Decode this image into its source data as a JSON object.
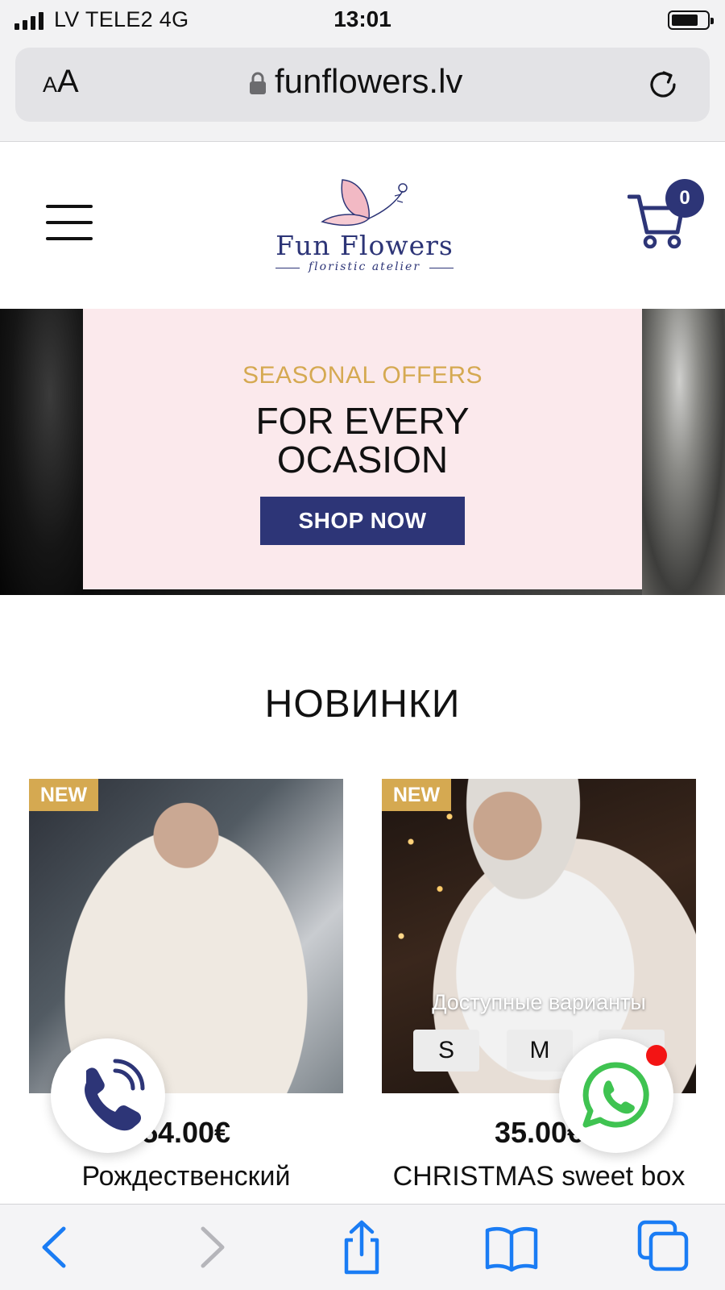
{
  "status_bar": {
    "carrier": "LV TELE2   4G",
    "time": "13:01"
  },
  "browser": {
    "text_size_small": "A",
    "text_size_large": "A",
    "url": "funflowers.lv",
    "icons": [
      "lock-icon",
      "reload-icon",
      "back-icon",
      "forward-icon",
      "share-icon",
      "bookmarks-icon",
      "tabs-icon"
    ]
  },
  "header": {
    "logo_title": "Fun Flowers",
    "logo_subtitle": "floristic atelier",
    "cart_count": "0",
    "icons": [
      "menu-icon",
      "cart-icon",
      "butterfly-logo-icon"
    ]
  },
  "hero": {
    "eyebrow": "SEASONAL OFFERS",
    "title_line1": "FOR EVERY",
    "title_line2": "OCASION",
    "button": "SHOP NOW"
  },
  "section": {
    "title": "НОВИНКИ"
  },
  "products": [
    {
      "badge": "NEW",
      "price": "54.00€",
      "name": "Рождественский"
    },
    {
      "badge": "NEW",
      "price": "35.00€",
      "name": "CHRISTMAS sweet box",
      "variants_label": "Доступные варианты",
      "variants": [
        "S",
        "M",
        "L"
      ]
    }
  ],
  "floating": {
    "icons": [
      "phone-icon",
      "whatsapp-icon"
    ]
  },
  "colors": {
    "brand_navy": "#2d3577",
    "gold": "#d5a951",
    "hero_pink": "#fbe9ec",
    "notification_red": "#f31414"
  }
}
